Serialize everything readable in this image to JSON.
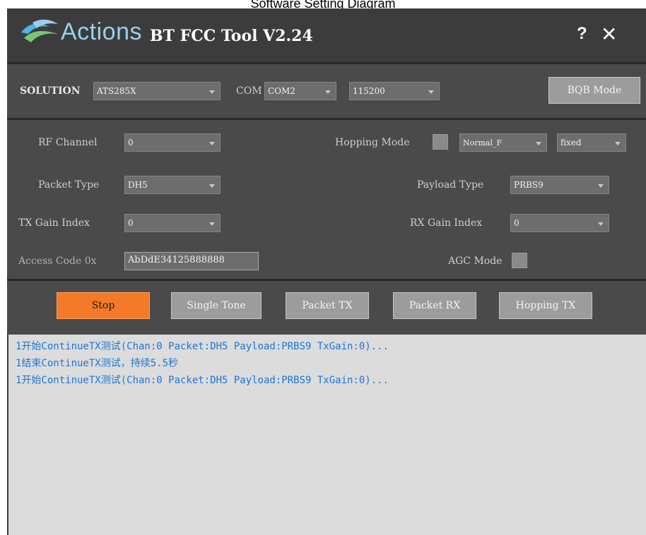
{
  "caption": "Software Setting Diagram",
  "window": {
    "brand": "Actions",
    "title": "BT FCC Tool V2.24",
    "help_label": "?",
    "close_label": "✕"
  },
  "top": {
    "solution_label": "SOLUTION",
    "solution_value": "ATS285X",
    "com_label": "COM",
    "com_value": "COM2",
    "baud_value": "115200",
    "bqb_button": "BQB Mode"
  },
  "settings": {
    "rf_channel_label": "RF Channel",
    "rf_channel_value": "0",
    "packet_type_label": "Packet Type",
    "packet_type_value": "DH5",
    "tx_gain_label": "TX Gain Index",
    "tx_gain_value": "0",
    "access_code_label": "Access Code 0x",
    "access_code_value": "AbDdE34125888888",
    "hopping_mode_label": "Hopping Mode",
    "hopping_mode_select": "Normal_F",
    "hopping_fixed_select": "fixed",
    "payload_type_label": "Payload Type",
    "payload_type_value": "PRBS9",
    "rx_gain_label": "RX Gain Index",
    "rx_gain_value": "0",
    "agc_mode_label": "AGC Mode"
  },
  "actions": {
    "stop": "Stop",
    "single_tone": "Single Tone",
    "packet_tx": "Packet TX",
    "packet_rx": "Packet RX",
    "hopping_tx": "Hopping TX"
  },
  "log": [
    "1开始ContinueTX测试(Chan:0 Packet:DH5 Payload:PRBS9 TxGain:0)...",
    "1结束ContinueTX测试，持续5.5秒",
    "1开始ContinueTX测试(Chan:0 Packet:DH5 Payload:PRBS9 TxGain:0)..."
  ],
  "colors": {
    "accent_orange": "#f47a2a",
    "log_text": "#1a77d6",
    "brand_blue": "#9ad0ee"
  }
}
